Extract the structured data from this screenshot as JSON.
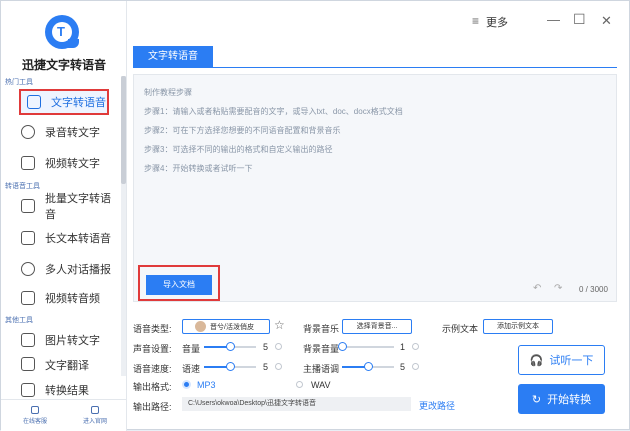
{
  "app": {
    "name": "迅捷文字转语音"
  },
  "titlebar": {
    "more_label": "更多",
    "menu_icon": "≡",
    "minimize_icon": "—",
    "maximize_icon": "☐",
    "close_icon": "✕"
  },
  "sidebar": {
    "groups": [
      {
        "title": "热门工具"
      },
      {
        "title": "转语音工具"
      },
      {
        "title": "其他工具"
      }
    ],
    "items": [
      {
        "label": "文字转语音",
        "active": true
      },
      {
        "label": "录音转文字"
      },
      {
        "label": "视频转文字"
      },
      {
        "label": "批量文字转语音"
      },
      {
        "label": "长文本转语音"
      },
      {
        "label": "多人对话播报"
      },
      {
        "label": "视频转音频"
      },
      {
        "label": "图片转文字"
      },
      {
        "label": "文字翻译"
      },
      {
        "label": "转换结果"
      }
    ],
    "bottom_links": [
      {
        "label": "在线客服"
      },
      {
        "label": "进入官网"
      }
    ]
  },
  "main": {
    "tab_label": "文字转语音",
    "editor": {
      "hints": [
        "制作教程步骤",
        "步骤1：请输入或者粘贴需要配音的文字，或导入txt、doc、docx格式文档",
        "步骤2：可在下方选择您想要的不同语音配置和背景音乐",
        "步骤3：可选择不同的输出的格式和自定义输出的路径",
        "步骤4：开始转换或者试听一下"
      ],
      "import_label": "导入文档",
      "counter": "0 / 3000",
      "undo_icon": "↶",
      "redo_icon": "↷"
    },
    "settings": {
      "voice_type_label": "语音类型:",
      "voice_button": "晋兮/活泼俏皮",
      "favorite_icon": "☆",
      "bg_music_label": "背景音乐",
      "bg_music_button": "选择背景音...",
      "sample_label": "示例文本",
      "sample_button": "添加示例文本",
      "sound_label": "声音设置:",
      "volume_label": "音量",
      "volume_value": "5",
      "volume_level": 0.5,
      "bg_volume_label": "背景音量",
      "bg_volume_value": "1",
      "bg_volume_level": 0.0,
      "speed_label": "语音速度:",
      "speed_sub_label": "语速",
      "speed_value": "5",
      "speed_level": 0.5,
      "pitch_label": "主播语调",
      "pitch_value": "5",
      "pitch_level": 0.5,
      "format_label": "输出格式:",
      "format_mp3": "MP3",
      "format_wav": "WAV",
      "selected_format": "MP3",
      "path_label": "输出路径:",
      "path_value": "C:\\Users\\okwoa\\Desktop\\迅捷文字转语音",
      "change_path": "更改路径"
    },
    "actions": {
      "listen_label": "试听一下",
      "start_label": "开始转换",
      "listen_icon": "🎧",
      "start_icon": "↻"
    }
  },
  "colors": {
    "accent": "#2b7df3",
    "highlight_border": "#e03a3a"
  }
}
